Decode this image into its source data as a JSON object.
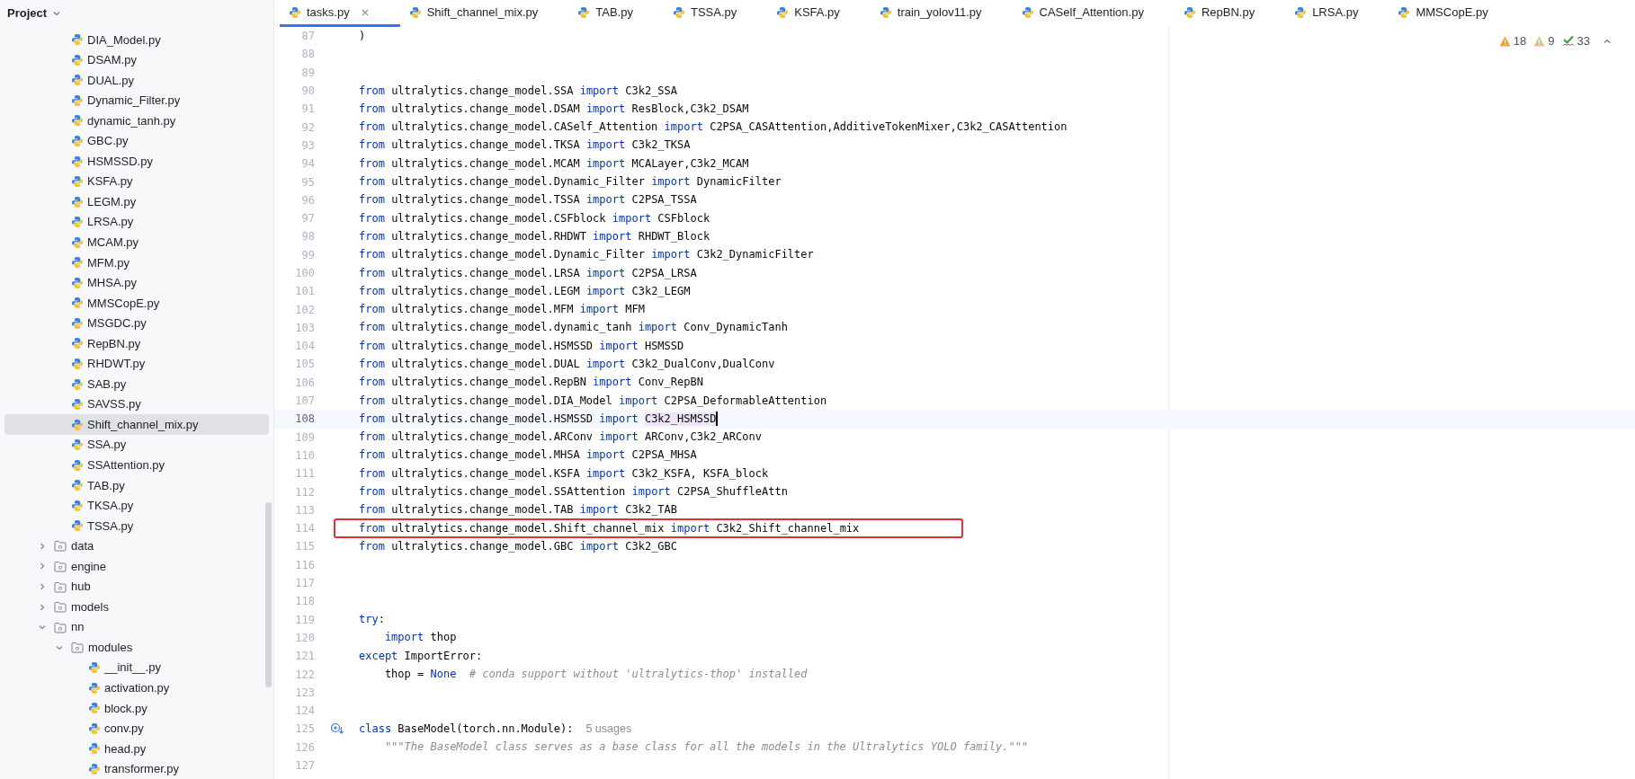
{
  "project": {
    "title": "Project",
    "hidden_parent_files": [
      {
        "label": "DIA_Model.py",
        "selected": false
      },
      {
        "label": "DSAM.py",
        "selected": false
      },
      {
        "label": "DUAL.py",
        "selected": false
      },
      {
        "label": "Dynamic_Filter.py",
        "selected": false
      },
      {
        "label": "dynamic_tanh.py",
        "selected": false
      },
      {
        "label": "GBC.py",
        "selected": false
      },
      {
        "label": "HSMSSD.py",
        "selected": false
      },
      {
        "label": "KSFA.py",
        "selected": false
      },
      {
        "label": "LEGM.py",
        "selected": false
      },
      {
        "label": "LRSA.py",
        "selected": false
      },
      {
        "label": "MCAM.py",
        "selected": false
      },
      {
        "label": "MFM.py",
        "selected": false
      },
      {
        "label": "MHSA.py",
        "selected": false
      },
      {
        "label": "MMSCopE.py",
        "selected": false
      },
      {
        "label": "MSGDC.py",
        "selected": false
      },
      {
        "label": "RepBN.py",
        "selected": false
      },
      {
        "label": "RHDWT.py",
        "selected": false
      },
      {
        "label": "SAB.py",
        "selected": false
      },
      {
        "label": "SAVSS.py",
        "selected": false
      },
      {
        "label": "Shift_channel_mix.py",
        "selected": true
      },
      {
        "label": "SSA.py",
        "selected": false
      },
      {
        "label": "SSAttention.py",
        "selected": false
      },
      {
        "label": "TAB.py",
        "selected": false
      },
      {
        "label": "TKSA.py",
        "selected": false
      },
      {
        "label": "TSSA.py",
        "selected": false
      }
    ],
    "tree": [
      {
        "label": "data",
        "kind": "folder",
        "expanded": false,
        "selected": false
      },
      {
        "label": "engine",
        "kind": "folder",
        "expanded": false,
        "selected": false
      },
      {
        "label": "hub",
        "kind": "folder",
        "expanded": false,
        "selected": false
      },
      {
        "label": "models",
        "kind": "folder",
        "expanded": false,
        "selected": false
      },
      {
        "label": "nn",
        "kind": "folder",
        "expanded": true,
        "selected": false,
        "children": [
          {
            "label": "modules",
            "kind": "folder",
            "expanded": true,
            "selected": false,
            "children": [
              {
                "label": "__init__.py",
                "kind": "file",
                "selected": false
              },
              {
                "label": "activation.py",
                "kind": "file",
                "selected": false
              },
              {
                "label": "block.py",
                "kind": "file",
                "selected": false
              },
              {
                "label": "conv.py",
                "kind": "file",
                "selected": false
              },
              {
                "label": "head.py",
                "kind": "file",
                "selected": false
              },
              {
                "label": "transformer.py",
                "kind": "file",
                "selected": false
              }
            ]
          }
        ]
      }
    ]
  },
  "tabs": [
    {
      "label": "tasks.py",
      "selected": true
    },
    {
      "label": "Shift_channel_mix.py",
      "selected": false
    },
    {
      "label": "TAB.py",
      "selected": false
    },
    {
      "label": "TSSA.py",
      "selected": false
    },
    {
      "label": "KSFA.py",
      "selected": false
    },
    {
      "label": "train_yolov11.py",
      "selected": false
    },
    {
      "label": "CASelf_Attention.py",
      "selected": false
    },
    {
      "label": "RepBN.py",
      "selected": false
    },
    {
      "label": "LRSA.py",
      "selected": false
    },
    {
      "label": "MMSCopE.py",
      "selected": false
    }
  ],
  "inspections": [
    {
      "kind": "warning",
      "count": "18"
    },
    {
      "kind": "weak_warning",
      "count": "9"
    },
    {
      "kind": "typo",
      "count": "33"
    }
  ],
  "editor": {
    "lines": [
      {
        "number": "87",
        "current": false,
        "tokens": [
          {
            "kind": "plain",
            "text": ")"
          }
        ]
      },
      {
        "number": "88",
        "current": false
      },
      {
        "number": "89",
        "current": false
      },
      {
        "number": "90",
        "current": false,
        "tokens": [
          {
            "kind": "keyword",
            "text": "from"
          },
          {
            "kind": "plain",
            "text": " ultralytics.change_model.SSA "
          },
          {
            "kind": "keyword",
            "text": "import"
          },
          {
            "kind": "plain",
            "text": " C3k2_SSA"
          }
        ]
      },
      {
        "number": "91",
        "current": false,
        "tokens": [
          {
            "kind": "keyword",
            "text": "from"
          },
          {
            "kind": "plain",
            "text": " ultralytics.change_model.DSAM "
          },
          {
            "kind": "keyword",
            "text": "import"
          },
          {
            "kind": "plain",
            "text": " ResBlock,C3k2_DSAM"
          }
        ]
      },
      {
        "number": "92",
        "current": false,
        "tokens": [
          {
            "kind": "keyword",
            "text": "from"
          },
          {
            "kind": "plain",
            "text": " ultralytics.change_model.CASelf_Attention "
          },
          {
            "kind": "keyword",
            "text": "import"
          },
          {
            "kind": "plain",
            "text": " C2PSA_CASAttention,AdditiveTokenMixer,C3k2_CASAttention"
          }
        ]
      },
      {
        "number": "93",
        "current": false,
        "tokens": [
          {
            "kind": "keyword",
            "text": "from"
          },
          {
            "kind": "plain",
            "text": " ultralytics.change_model.TKSA "
          },
          {
            "kind": "keyword",
            "text": "import"
          },
          {
            "kind": "plain",
            "text": " C3k2_TKSA"
          }
        ]
      },
      {
        "number": "94",
        "current": false,
        "tokens": [
          {
            "kind": "keyword",
            "text": "from"
          },
          {
            "kind": "plain",
            "text": " ultralytics.change_model.MCAM "
          },
          {
            "kind": "keyword",
            "text": "import"
          },
          {
            "kind": "plain",
            "text": " MCALayer,C3k2_MCAM"
          }
        ]
      },
      {
        "number": "95",
        "current": false,
        "tokens": [
          {
            "kind": "keyword",
            "text": "from"
          },
          {
            "kind": "plain",
            "text": " ultralytics.change_model.Dynamic_Filter "
          },
          {
            "kind": "keyword",
            "text": "import"
          },
          {
            "kind": "plain",
            "text": " DynamicFilter"
          }
        ]
      },
      {
        "number": "96",
        "current": false,
        "tokens": [
          {
            "kind": "keyword",
            "text": "from"
          },
          {
            "kind": "plain",
            "text": " ultralytics.change_model.TSSA "
          },
          {
            "kind": "keyword",
            "text": "import"
          },
          {
            "kind": "plain",
            "text": " C2PSA_TSSA"
          }
        ]
      },
      {
        "number": "97",
        "current": false,
        "tokens": [
          {
            "kind": "keyword",
            "text": "from"
          },
          {
            "kind": "plain",
            "text": " ultralytics.change_model.CSFblock "
          },
          {
            "kind": "keyword",
            "text": "import"
          },
          {
            "kind": "plain",
            "text": " CSFblock"
          }
        ]
      },
      {
        "number": "98",
        "current": false,
        "tokens": [
          {
            "kind": "keyword",
            "text": "from"
          },
          {
            "kind": "plain",
            "text": " ultralytics.change_model.RHDWT "
          },
          {
            "kind": "keyword",
            "text": "import"
          },
          {
            "kind": "plain",
            "text": " RHDWT_Block"
          }
        ]
      },
      {
        "number": "99",
        "current": false,
        "tokens": [
          {
            "kind": "keyword",
            "text": "from"
          },
          {
            "kind": "plain",
            "text": " ultralytics.change_model.Dynamic_Filter "
          },
          {
            "kind": "keyword",
            "text": "import"
          },
          {
            "kind": "plain",
            "text": " C3k2_DynamicFilter"
          }
        ]
      },
      {
        "number": "100",
        "current": false,
        "tokens": [
          {
            "kind": "keyword",
            "text": "from"
          },
          {
            "kind": "plain",
            "text": " ultralytics.change_model.LRSA "
          },
          {
            "kind": "keyword",
            "text": "import"
          },
          {
            "kind": "plain",
            "text": " C2PSA_LRSA"
          }
        ]
      },
      {
        "number": "101",
        "current": false,
        "tokens": [
          {
            "kind": "keyword",
            "text": "from"
          },
          {
            "kind": "plain",
            "text": " ultralytics.change_model.LEGM "
          },
          {
            "kind": "keyword",
            "text": "import"
          },
          {
            "kind": "plain",
            "text": " C3k2_LEGM"
          }
        ]
      },
      {
        "number": "102",
        "current": false,
        "tokens": [
          {
            "kind": "keyword",
            "text": "from"
          },
          {
            "kind": "plain",
            "text": " ultralytics.change_model.MFM "
          },
          {
            "kind": "keyword",
            "text": "import"
          },
          {
            "kind": "plain",
            "text": " MFM"
          }
        ]
      },
      {
        "number": "103",
        "current": false,
        "tokens": [
          {
            "kind": "keyword",
            "text": "from"
          },
          {
            "kind": "plain",
            "text": " ultralytics.change_model.dynamic_tanh "
          },
          {
            "kind": "keyword",
            "text": "import"
          },
          {
            "kind": "plain",
            "text": " Conv_DynamicTanh"
          }
        ]
      },
      {
        "number": "104",
        "current": false,
        "tokens": [
          {
            "kind": "keyword",
            "text": "from"
          },
          {
            "kind": "plain",
            "text": " ultralytics.change_model.HSMSSD "
          },
          {
            "kind": "keyword",
            "text": "import"
          },
          {
            "kind": "plain",
            "text": " HSMSSD"
          }
        ]
      },
      {
        "number": "105",
        "current": false,
        "tokens": [
          {
            "kind": "keyword",
            "text": "from"
          },
          {
            "kind": "plain",
            "text": " ultralytics.change_model.DUAL "
          },
          {
            "kind": "keyword",
            "text": "import"
          },
          {
            "kind": "plain",
            "text": " C3k2_DualConv,DualConv"
          }
        ]
      },
      {
        "number": "106",
        "current": false,
        "tokens": [
          {
            "kind": "keyword",
            "text": "from"
          },
          {
            "kind": "plain",
            "text": " ultralytics.change_model.RepBN "
          },
          {
            "kind": "keyword",
            "text": "import"
          },
          {
            "kind": "plain",
            "text": " Conv_RepBN"
          }
        ]
      },
      {
        "number": "107",
        "current": false,
        "tokens": [
          {
            "kind": "keyword",
            "text": "from"
          },
          {
            "kind": "plain",
            "text": " ultralytics.change_model.DIA_Model "
          },
          {
            "kind": "keyword",
            "text": "import"
          },
          {
            "kind": "plain",
            "text": " C2PSA_DeformableAttention"
          }
        ]
      },
      {
        "number": "108",
        "current": true,
        "tokens": [
          {
            "kind": "keyword",
            "text": "from"
          },
          {
            "kind": "plain",
            "text": " ultralytics.change_model.HSMSSD "
          },
          {
            "kind": "keyword",
            "text": "import "
          },
          {
            "kind": "match",
            "text": "C3k2_HSMSSD"
          }
        ]
      },
      {
        "number": "109",
        "current": false,
        "tokens": [
          {
            "kind": "keyword",
            "text": "from"
          },
          {
            "kind": "plain",
            "text": " ultralytics.change_model.ARConv "
          },
          {
            "kind": "keyword",
            "text": "import"
          },
          {
            "kind": "plain",
            "text": " ARConv,C3k2_ARConv"
          }
        ]
      },
      {
        "number": "110",
        "current": false,
        "tokens": [
          {
            "kind": "keyword",
            "text": "from"
          },
          {
            "kind": "plain",
            "text": " ultralytics.change_model.MHSA "
          },
          {
            "kind": "keyword",
            "text": "import"
          },
          {
            "kind": "plain",
            "text": " C2PSA_MHSA"
          }
        ]
      },
      {
        "number": "111",
        "current": false,
        "tokens": [
          {
            "kind": "keyword",
            "text": "from"
          },
          {
            "kind": "plain",
            "text": " ultralytics.change_model.KSFA "
          },
          {
            "kind": "keyword",
            "text": "import"
          },
          {
            "kind": "plain",
            "text": " C3k2_KSFA, KSFA_block"
          }
        ]
      },
      {
        "number": "112",
        "current": false,
        "tokens": [
          {
            "kind": "keyword",
            "text": "from"
          },
          {
            "kind": "plain",
            "text": " ultralytics.change_model.SSAttention "
          },
          {
            "kind": "keyword",
            "text": "import"
          },
          {
            "kind": "plain",
            "text": " C2PSA_ShuffleAttn"
          }
        ]
      },
      {
        "number": "113",
        "current": false,
        "tokens": [
          {
            "kind": "keyword",
            "text": "from"
          },
          {
            "kind": "plain",
            "text": " ultralytics.change_model.TAB "
          },
          {
            "kind": "keyword",
            "text": "import"
          },
          {
            "kind": "plain",
            "text": " C3k2_TAB"
          }
        ]
      },
      {
        "number": "114",
        "current": false,
        "boxed": true,
        "tokens": [
          {
            "kind": "keyword",
            "text": "from"
          },
          {
            "kind": "plain",
            "text": " ultralytics.change_model.Shift_channel_mix "
          },
          {
            "kind": "keyword",
            "text": "import"
          },
          {
            "kind": "plain",
            "text": " C3k2_Shift_channel_mix"
          }
        ]
      },
      {
        "number": "115",
        "current": false,
        "tokens": [
          {
            "kind": "keyword",
            "text": "from"
          },
          {
            "kind": "plain",
            "text": " ultralytics.change_model.GBC "
          },
          {
            "kind": "keyword",
            "text": "import"
          },
          {
            "kind": "plain",
            "text": " C3k2_GBC"
          }
        ]
      },
      {
        "number": "116",
        "current": false
      },
      {
        "number": "117",
        "current": false
      },
      {
        "number": "118",
        "current": false
      },
      {
        "number": "119",
        "current": false,
        "tokens": [
          {
            "kind": "keyword",
            "text": "try"
          },
          {
            "kind": "plain",
            "text": ":"
          }
        ]
      },
      {
        "number": "120",
        "current": false,
        "indented": true,
        "tokens": [
          {
            "kind": "keyword",
            "text": "import"
          },
          {
            "kind": "plain",
            "text": " thop"
          }
        ]
      },
      {
        "number": "121",
        "current": false,
        "tokens": [
          {
            "kind": "keyword",
            "text": "except"
          },
          {
            "kind": "plain",
            "text": " ImportError:"
          }
        ]
      },
      {
        "number": "122",
        "current": false,
        "indented": true,
        "tokens": [
          {
            "kind": "plain",
            "text": "thop = "
          },
          {
            "kind": "keyword",
            "text": "None"
          },
          {
            "kind": "comment",
            "text": "  # conda support without 'ultralytics-thop' installed"
          }
        ]
      },
      {
        "number": "123",
        "current": false
      },
      {
        "number": "124",
        "current": false
      },
      {
        "number": "125",
        "current": false,
        "override_marker": true,
        "tokens": [
          {
            "kind": "keyword",
            "text": "class"
          },
          {
            "kind": "plain",
            "text": " BaseModel(torch.nn.Module):"
          },
          {
            "kind": "hint",
            "text": "5 usages"
          }
        ]
      },
      {
        "number": "126",
        "current": false,
        "indented": true,
        "tokens": [
          {
            "kind": "docstring",
            "text": "\"\"\"The BaseModel class serves as a base class for all the models in the Ultralytics YOLO family.\"\"\""
          }
        ]
      },
      {
        "number": "127",
        "current": false
      }
    ]
  }
}
